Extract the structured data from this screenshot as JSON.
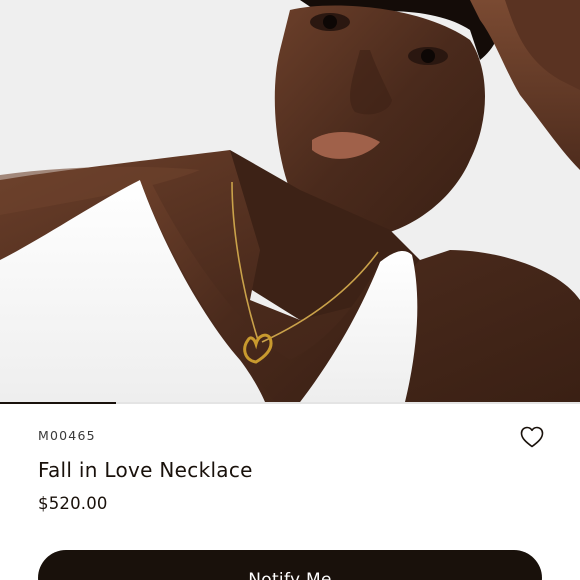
{
  "product": {
    "sku": "M00465",
    "name": "Fall in Love Necklace",
    "price": "$520.00",
    "notify_label": "Notify Me"
  },
  "carousel": {
    "progress": 0.2
  },
  "icons": {
    "wishlist": "heart-outline-icon"
  },
  "colors": {
    "text": "#19110b",
    "button_bg": "#19110b",
    "button_text": "#ffffff",
    "pendant_gold": "#c99a2e"
  }
}
